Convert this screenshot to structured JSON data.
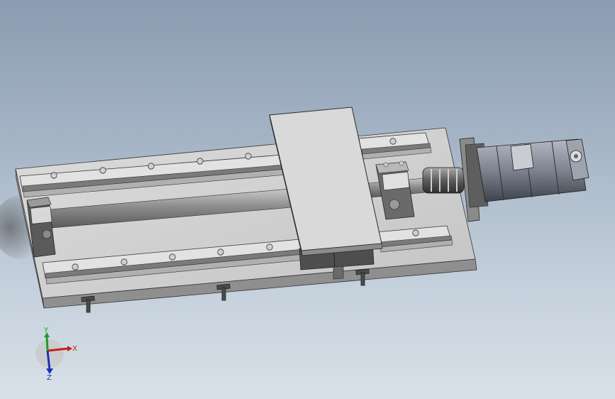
{
  "triad": {
    "x_label": "X",
    "y_label": "Y",
    "z_label": "Z"
  },
  "colors": {
    "background_top": "#8a9cb1",
    "background_bottom": "#d9e1e8",
    "part_light": "#d2d2d2",
    "part_mid": "#a8a8a8",
    "part_dark": "#4a4a4a",
    "x_axis": "#c81e1e",
    "y_axis": "#1e9b2a",
    "z_axis": "#1e2fb0"
  },
  "parts": [
    "base-plate",
    "linear-rail-rear",
    "linear-rail-front",
    "carriage-table",
    "ball-screw",
    "end-support-block",
    "bearing-support-block",
    "shaft-coupling",
    "motor-flange",
    "servo-motor",
    "limit-sensors"
  ]
}
